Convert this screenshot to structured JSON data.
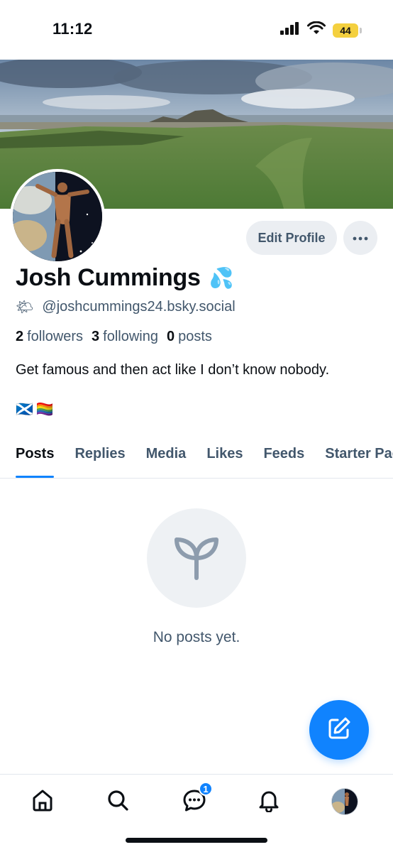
{
  "status_bar": {
    "time": "11:12",
    "battery": "44",
    "signal_icon": "cellular-signal-icon",
    "wifi_icon": "wifi-icon"
  },
  "profile": {
    "display_name": "Josh Cummings",
    "name_emoji": "💦",
    "handle_emoji": "🌤",
    "handle": "@joshcummings24.bsky.social",
    "followers_count": "2",
    "followers_label": "followers",
    "following_count": "3",
    "following_label": "following",
    "posts_count": "0",
    "posts_label": "posts",
    "bio": "Get famous and then act like I don’t know nobody.",
    "flags": [
      "🏴󠁧󠁢󠁳󠁣󠁴󠁿",
      "🏳️‍🌈"
    ]
  },
  "actions": {
    "edit_profile_label": "Edit Profile",
    "more_icon": "ellipsis-icon"
  },
  "tabs": [
    {
      "label": "Posts",
      "active": true
    },
    {
      "label": "Replies",
      "active": false
    },
    {
      "label": "Media",
      "active": false
    },
    {
      "label": "Likes",
      "active": false
    },
    {
      "label": "Feeds",
      "active": false
    },
    {
      "label": "Starter Packs",
      "active": false
    }
  ],
  "empty_state": {
    "icon": "sprout-icon",
    "text": "No posts yet."
  },
  "fab": {
    "icon": "compose-icon"
  },
  "bottom_nav": {
    "items": [
      "home-icon",
      "search-icon",
      "chat-icon",
      "bell-icon",
      "profile-avatar"
    ],
    "chat_badge": "1"
  },
  "colors": {
    "accent": "#1083fe",
    "muted_text": "#42576c",
    "button_bg": "#ebeef2"
  }
}
